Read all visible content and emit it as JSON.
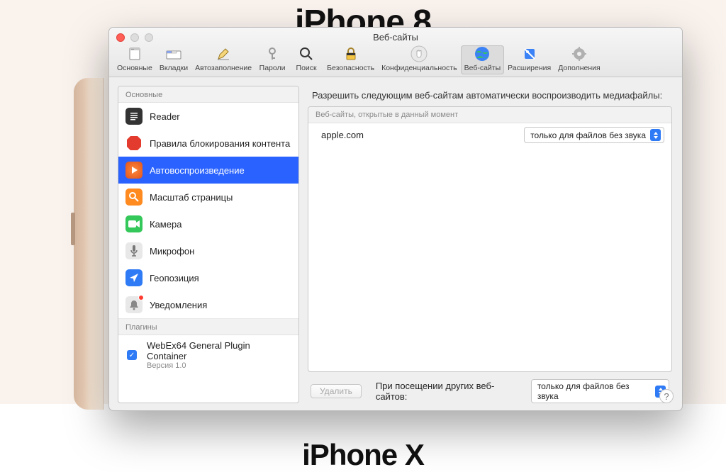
{
  "background": {
    "title_top": "iPhone 8",
    "title_bottom": "iPhone X"
  },
  "window": {
    "title": "Веб-сайты",
    "toolbar": [
      {
        "id": "general",
        "label": "Основные"
      },
      {
        "id": "tabs",
        "label": "Вкладки"
      },
      {
        "id": "autofill",
        "label": "Автозаполнение"
      },
      {
        "id": "passwords",
        "label": "Пароли"
      },
      {
        "id": "search",
        "label": "Поиск"
      },
      {
        "id": "security",
        "label": "Безопасность"
      },
      {
        "id": "privacy",
        "label": "Конфиденциальность"
      },
      {
        "id": "websites",
        "label": "Веб-сайты",
        "active": true
      },
      {
        "id": "extensions",
        "label": "Расширения"
      },
      {
        "id": "advanced",
        "label": "Дополнения"
      }
    ]
  },
  "sidebar": {
    "group_general": "Основные",
    "group_plugins": "Плагины",
    "items": [
      {
        "id": "reader",
        "label": "Reader"
      },
      {
        "id": "content-block",
        "label": "Правила блокирования контента"
      },
      {
        "id": "autoplay",
        "label": "Автовоспроизведение",
        "selected": true
      },
      {
        "id": "zoom",
        "label": "Масштаб страницы"
      },
      {
        "id": "camera",
        "label": "Камера"
      },
      {
        "id": "microphone",
        "label": "Микрофон"
      },
      {
        "id": "location",
        "label": "Геопозиция"
      },
      {
        "id": "notifications",
        "label": "Уведомления"
      }
    ],
    "plugin": {
      "label": "WebEx64 General Plugin Container",
      "version": "Версия 1.0"
    }
  },
  "main": {
    "heading": "Разрешить следующим веб-сайтам автоматически воспроизводить медиафайлы:",
    "list_header": "Веб-сайты, открытые в данный момент",
    "rows": [
      {
        "site": "apple.com",
        "policy": "только для файлов без звука"
      }
    ],
    "delete_label": "Удалить",
    "other_sites_label": "При посещении других веб-сайтов:",
    "other_sites_value": "только для файлов без звука"
  }
}
